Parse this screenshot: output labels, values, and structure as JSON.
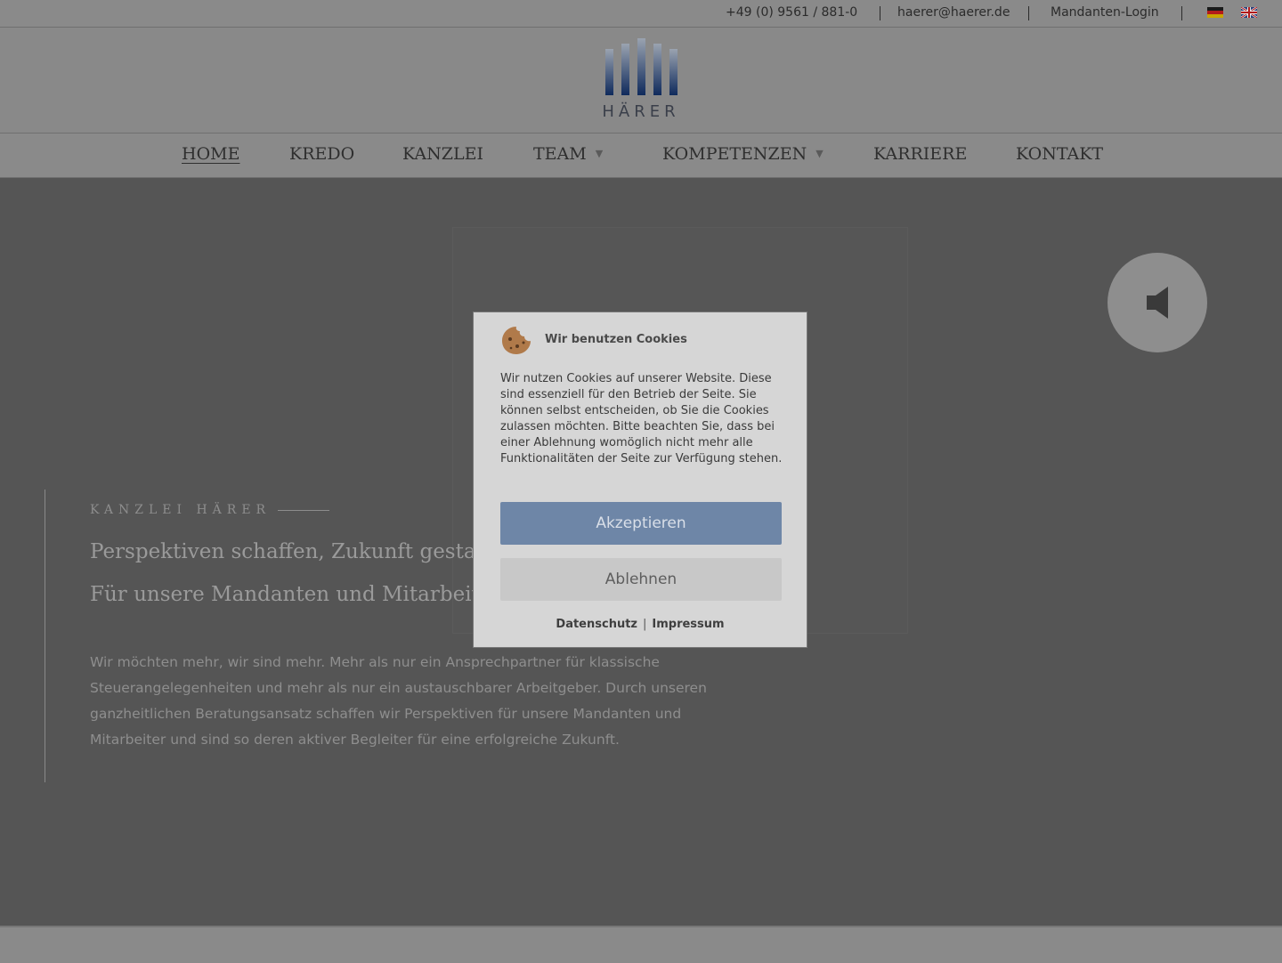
{
  "topbar": {
    "phone": "+49 (0) 9561 / 881-0",
    "email": "haerer@haerer.de",
    "login": "Mandanten-Login"
  },
  "logo": {
    "text": "HÄRER"
  },
  "nav": {
    "items": [
      {
        "label": "HOME"
      },
      {
        "label": "KREDO"
      },
      {
        "label": "KANZLEI"
      },
      {
        "label": "TEAM"
      },
      {
        "label": "KOMPETENZEN"
      },
      {
        "label": "KARRIERE"
      },
      {
        "label": "KONTAKT"
      }
    ]
  },
  "hero": {
    "eyebrow": "KANZLEI HÄRER",
    "headline1": "Perspektiven schaffen, Zukunft gestalten.",
    "headline2": "Für unsere Mandanten und Mitarbeiter.",
    "text": "Wir möchten mehr, wir sind mehr. Mehr als nur ein Ansprechpartner für klassische Steuerangelegenheiten und mehr als nur ein austauschbarer Arbeitgeber. Durch unseren ganzheitlichen Beratungsansatz schaffen wir Perspektiven für unsere Mandanten und Mitarbeiter und sind so deren aktiver Begleiter für eine erfolgreiche Zukunft."
  },
  "cookie": {
    "title": "Wir benutzen Cookies",
    "body": "Wir nutzen Cookies auf unserer Website. Diese sind essenziell für den Betrieb der Seite. Sie können selbst entscheiden, ob Sie die Cookies zulassen möchten. Bitte beachten Sie, dass bei einer Ablehnung womöglich nicht mehr alle Funktionalitäten der Seite zur Verfügung stehen.",
    "accept": "Akzeptieren",
    "decline": "Ablehnen",
    "privacy": "Datenschutz",
    "imprint": "Impressum"
  },
  "colors": {
    "accent": "#6e86a7",
    "overlay": "#555555"
  }
}
